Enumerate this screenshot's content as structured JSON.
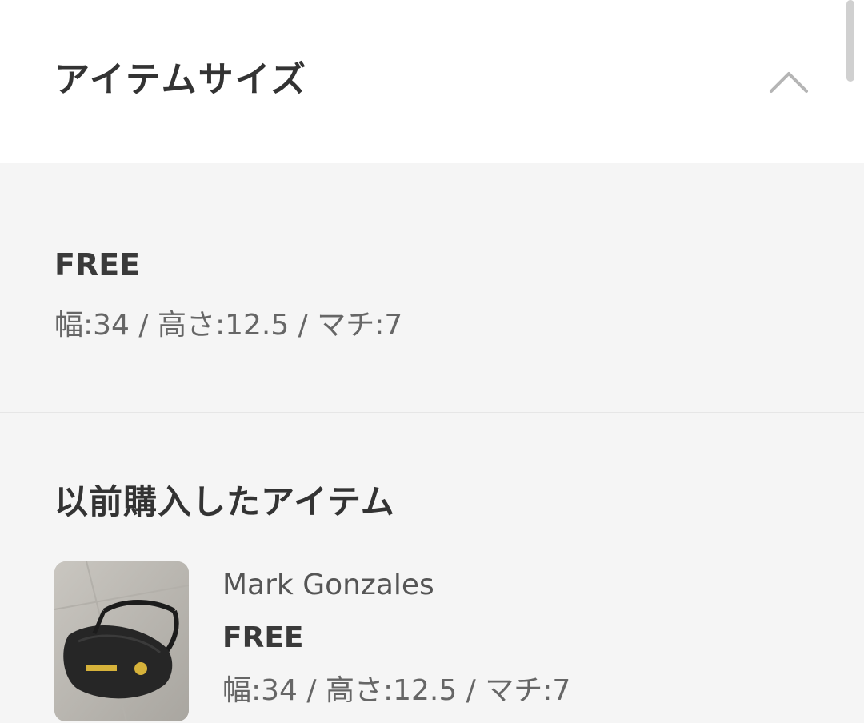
{
  "section": {
    "title": "アイテムサイズ",
    "toggle_icon": "chevron-up-icon"
  },
  "size": {
    "name": "FREE",
    "dimensions": "幅:34 / 高さ:12.5 / マチ:7"
  },
  "previous": {
    "title": "以前購入したアイテム",
    "items": [
      {
        "brand": "Mark Gonzales",
        "size": "FREE",
        "dimensions": "幅:34 / 高さ:12.5 / マチ:7",
        "thumbnail": "waist-bag-photo"
      }
    ]
  },
  "colors": {
    "header_bg": "#ffffff",
    "body_bg": "#f5f5f5",
    "title_text": "#333333",
    "muted_text": "#666666",
    "chevron": "#b5b5b5"
  }
}
